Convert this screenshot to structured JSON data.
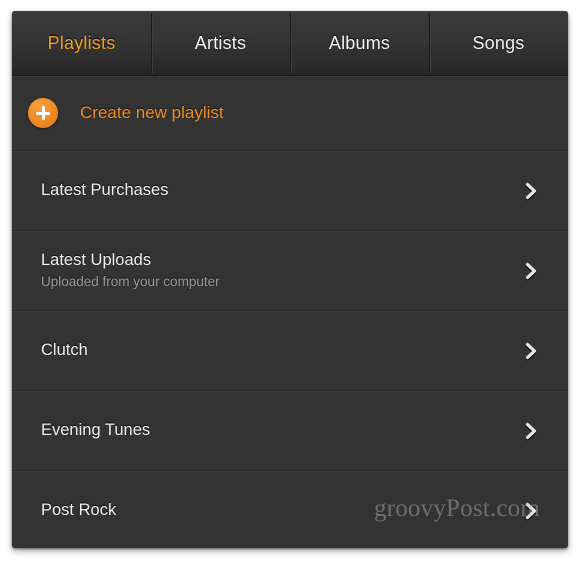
{
  "app": {
    "accent_color": "#ee8c24",
    "active_tab_color": "#f0a020",
    "background_color": "#333333",
    "tab_bar_color": "#343434"
  },
  "tabs": [
    {
      "label": "Playlists",
      "active": true
    },
    {
      "label": "Artists",
      "active": false
    },
    {
      "label": "Albums",
      "active": false
    },
    {
      "label": "Songs",
      "active": false
    }
  ],
  "create_row": {
    "label": "Create new playlist",
    "icon": "plus-circle-icon"
  },
  "playlists": [
    {
      "title": "Latest Purchases",
      "subtitle": "",
      "chevron": "chevron-right-icon"
    },
    {
      "title": "Latest Uploads",
      "subtitle": "Uploaded from your computer",
      "chevron": "chevron-right-icon"
    },
    {
      "title": "Clutch",
      "subtitle": "",
      "chevron": "chevron-right-icon"
    },
    {
      "title": "Evening Tunes",
      "subtitle": "",
      "chevron": "chevron-right-icon"
    },
    {
      "title": "Post Rock",
      "subtitle": "",
      "chevron": "chevron-right-icon"
    }
  ],
  "watermark": {
    "text": "groovyPost.com"
  }
}
